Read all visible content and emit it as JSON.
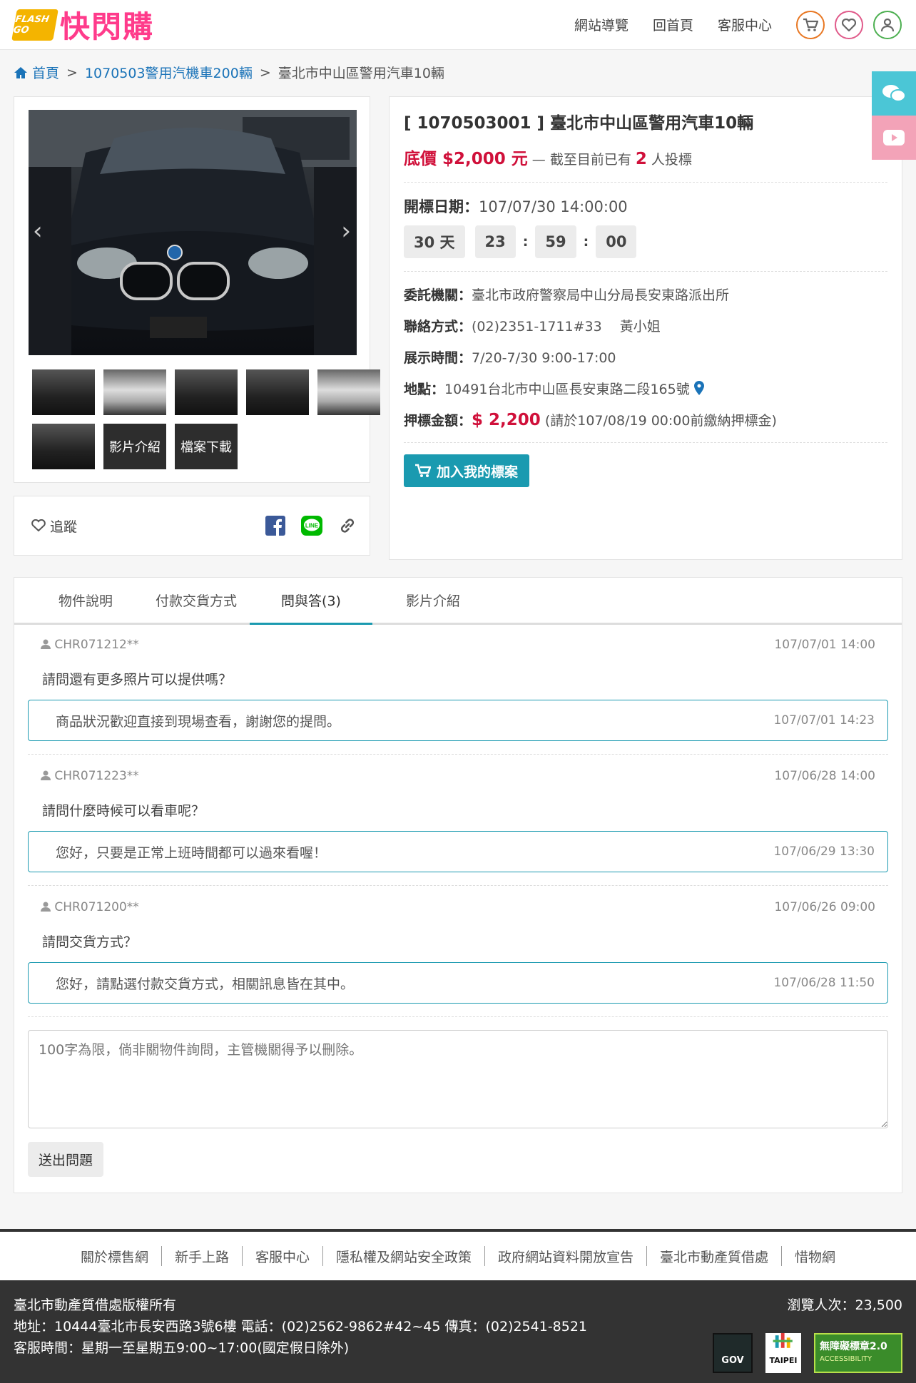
{
  "header": {
    "logo_flash": "FLASH GO",
    "logo_text": "快閃購",
    "nav": [
      "網站導覽",
      "回首頁",
      "客服中心"
    ]
  },
  "breadcrumb": {
    "home": "首頁",
    "category": "1070503警用汽機車200輛",
    "current": "臺北市中山區警用汽車10輛"
  },
  "gallery": {
    "video_label": "影片介紹",
    "download_label": "檔案下載",
    "follow_label": "追蹤"
  },
  "item": {
    "title": "[ 1070503001 ] 臺北市中山區警用汽車10輛",
    "price_label": "底價 $2,000 元",
    "bid_prefix": "— 截至目前已有",
    "bid_count": "2",
    "bid_suffix": "人投標",
    "open_date_label": "開標日期：",
    "open_date": "107/07/30  14:00:00",
    "countdown": {
      "days": "30 天",
      "hours": "23",
      "minutes": "59",
      "seconds": "00"
    },
    "agency_label": "委託機關：",
    "agency": "臺北市政府警察局中山分局長安東路派出所",
    "contact_label": "聯絡方式：",
    "contact": "(02)2351-1711#33　 黃小姐",
    "display_label": "展示時間：",
    "display": "7/20-7/30 9:00-17:00",
    "address_label": "地點：",
    "address": "10491台北市中山區長安東路二段165號",
    "deposit_label": "押標金額：",
    "deposit_amount": "$ 2,200",
    "deposit_note": "(請於107/08/19 00:00前繳納押標金)",
    "add_button": "加入我的標案"
  },
  "tabs": [
    "物件說明",
    "付款交貨方式",
    "問與答(3)",
    "影片介紹"
  ],
  "qa": [
    {
      "user": "CHR071212**",
      "time": "107/07/01 14:00",
      "question": "請問還有更多照片可以提供嗎？",
      "answer": "商品狀況歡迎直接到現場查看，謝謝您的提問。",
      "answer_time": "107/07/01 14:23"
    },
    {
      "user": "CHR071223**",
      "time": "107/06/28 14:00",
      "question": "請問什麼時候可以看車呢？",
      "answer": "您好，只要是正常上班時間都可以過來看喔！",
      "answer_time": "107/06/29 13:30"
    },
    {
      "user": "CHR071200**",
      "time": "107/06/26 09:00",
      "question": "請問交貨方式？",
      "answer": "您好，請點選付款交貨方式，相關訊息皆在其中。",
      "answer_time": "107/06/28 11:50"
    }
  ],
  "question_form": {
    "placeholder": "100字為限，倘非關物件詢問，主管機關得予以刪除。",
    "submit": "送出問題"
  },
  "footer_nav": [
    "關於標售網",
    "新手上路",
    "客服中心",
    "隱私權及網站安全政策",
    "政府網站資料開放宣告",
    "臺北市動產質借處",
    "惜物網"
  ],
  "footer": {
    "copyright": "臺北市動產質借處版權所有",
    "address": "地址：10444臺北市長安西路3號6樓 電話：(02)2562-9862#42~45 傳真：(02)2541-8521",
    "hours": "客服時間：星期一至星期五9:00~17:00(國定假日除外)",
    "views": "瀏覽人次：23,500",
    "badge_gov": "GOV",
    "badge_taipei": "TAIPEI",
    "badge_access": "無障礙標章2.0",
    "badge_access_sub": "ACCESSIBILITY"
  },
  "colors": {
    "accent": "#1a9ab0",
    "price": "#d0103a",
    "link": "#1a73b8",
    "brand": "#ff3b8b"
  }
}
